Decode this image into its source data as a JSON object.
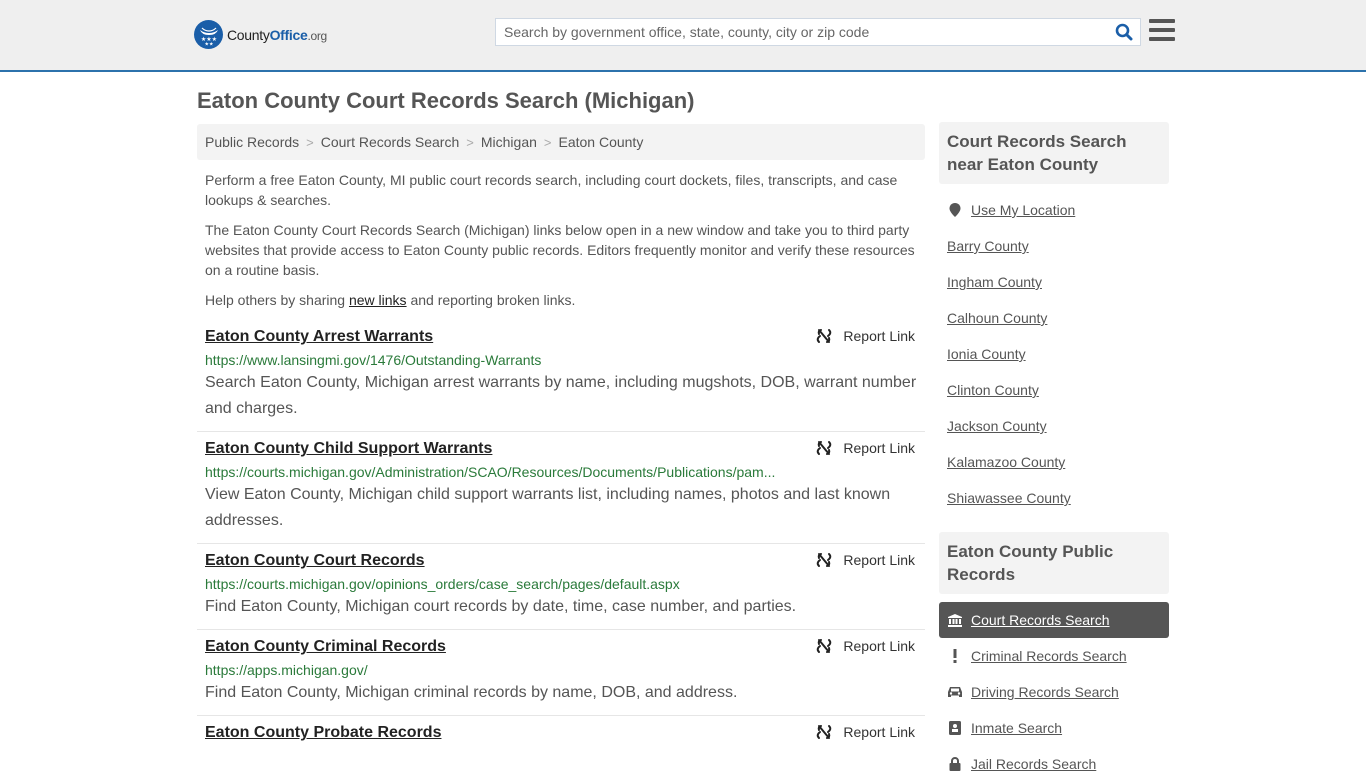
{
  "header": {
    "logo": {
      "county": "County",
      "office": "Office",
      "org": ".org"
    },
    "search_placeholder": "Search by government office, state, county, city or zip code",
    "search_value": "",
    "accent_color": "#2c72ac"
  },
  "page_title": "Eaton County Court Records Search (Michigan)",
  "breadcrumb": [
    "Public Records",
    "Court Records Search",
    "Michigan",
    "Eaton County"
  ],
  "intro": {
    "p1": "Perform a free Eaton County, MI public court records search, including court dockets, files, transcripts, and case lookups & searches.",
    "p2": "The Eaton County Court Records Search (Michigan) links below open in a new window and take you to third party websites that provide access to Eaton County public records. Editors frequently monitor and verify these resources on a routine basis.",
    "p3_before": "Help others by sharing ",
    "p3_link": "new links",
    "p3_after": " and reporting broken links."
  },
  "results": [
    {
      "title": "Eaton County Arrest Warrants",
      "url": "https://www.lansingmi.gov/1476/Outstanding-Warrants",
      "description": "Search Eaton County, Michigan arrest warrants by name, including mugshots, DOB, warrant number and charges.",
      "report": "Report Link"
    },
    {
      "title": "Eaton County Child Support Warrants",
      "url": "https://courts.michigan.gov/Administration/SCAO/Resources/Documents/Publications/pam...",
      "description": "View Eaton County, Michigan child support warrants list, including names, photos and last known addresses.",
      "report": "Report Link"
    },
    {
      "title": "Eaton County Court Records",
      "url": "https://courts.michigan.gov/opinions_orders/case_search/pages/default.aspx",
      "description": "Find Eaton County, Michigan court records by date, time, case number, and parties.",
      "report": "Report Link"
    },
    {
      "title": "Eaton County Criminal Records",
      "url": "https://apps.michigan.gov/",
      "description": "Find Eaton County, Michigan criminal records by name, DOB, and address.",
      "report": "Report Link"
    },
    {
      "title": "Eaton County Probate Records",
      "url": "",
      "description": "",
      "report": "Report Link"
    }
  ],
  "sidebar": {
    "nearby_heading": "Court Records Search near Eaton County",
    "use_location": "Use My Location",
    "nearby": [
      "Barry County",
      "Ingham County",
      "Calhoun County",
      "Ionia County",
      "Clinton County",
      "Jackson County",
      "Kalamazoo County",
      "Shiawassee County"
    ],
    "public_heading": "Eaton County Public Records",
    "nav": [
      {
        "label": "Court Records Search",
        "icon": "courthouse-icon",
        "active": true
      },
      {
        "label": "Criminal Records Search",
        "icon": "exclamation-icon",
        "active": false
      },
      {
        "label": "Driving Records Search",
        "icon": "car-icon",
        "active": false
      },
      {
        "label": "Inmate Search",
        "icon": "id-badge-icon",
        "active": false
      },
      {
        "label": "Jail Records Search",
        "icon": "lock-icon",
        "active": false
      }
    ]
  }
}
